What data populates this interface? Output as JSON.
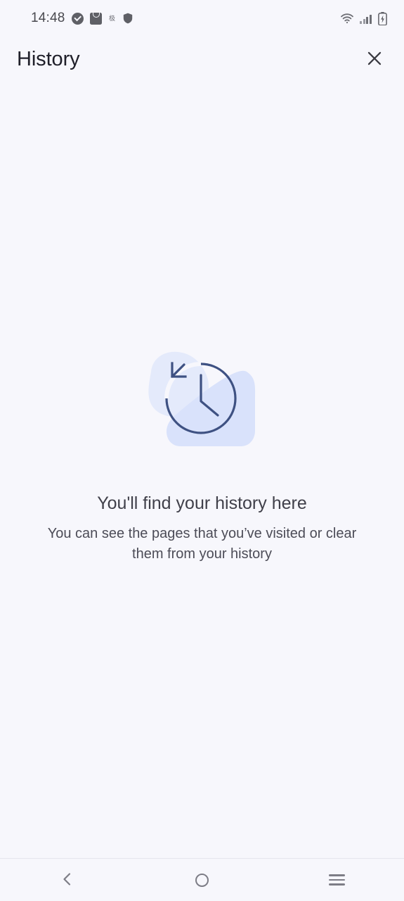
{
  "status_bar": {
    "time": "14:48",
    "left_icons": [
      {
        "name": "check-circle-icon",
        "label": "checkmark badge"
      },
      {
        "name": "shopping-bag-icon",
        "label": "shopping bag"
      },
      {
        "name": "glyph-badge-icon",
        "label": "极速",
        "glyph": "极"
      },
      {
        "name": "shield-icon",
        "label": "security shield"
      }
    ],
    "right_icons": [
      {
        "name": "wifi-icon",
        "label": "wifi"
      },
      {
        "name": "signal-icon",
        "label": "cellular signal"
      },
      {
        "name": "battery-charging-icon",
        "label": "battery charging"
      }
    ]
  },
  "header": {
    "title": "History",
    "close_label": "Close"
  },
  "empty_state": {
    "illustration_name": "history-clock-illustration",
    "heading": "You'll find your history here",
    "subtitle": "You can see the pages that you’ve visited or clear them from your history"
  },
  "nav_bar": {
    "back_label": "Back",
    "home_label": "Home",
    "recents_label": "Recent apps"
  },
  "colors": {
    "page_background": "#f7f7fc",
    "title_text": "#20202a",
    "heading_text": "#40404a",
    "body_text": "#4c4c57",
    "illustration_blob_light": "#e4eafb",
    "illustration_blob_dark": "#d9e2fb",
    "illustration_stroke": "#3e5182",
    "nav_icon": "#7d7d86",
    "status_icon": "#5f6066",
    "divider": "#e6e6ee"
  }
}
